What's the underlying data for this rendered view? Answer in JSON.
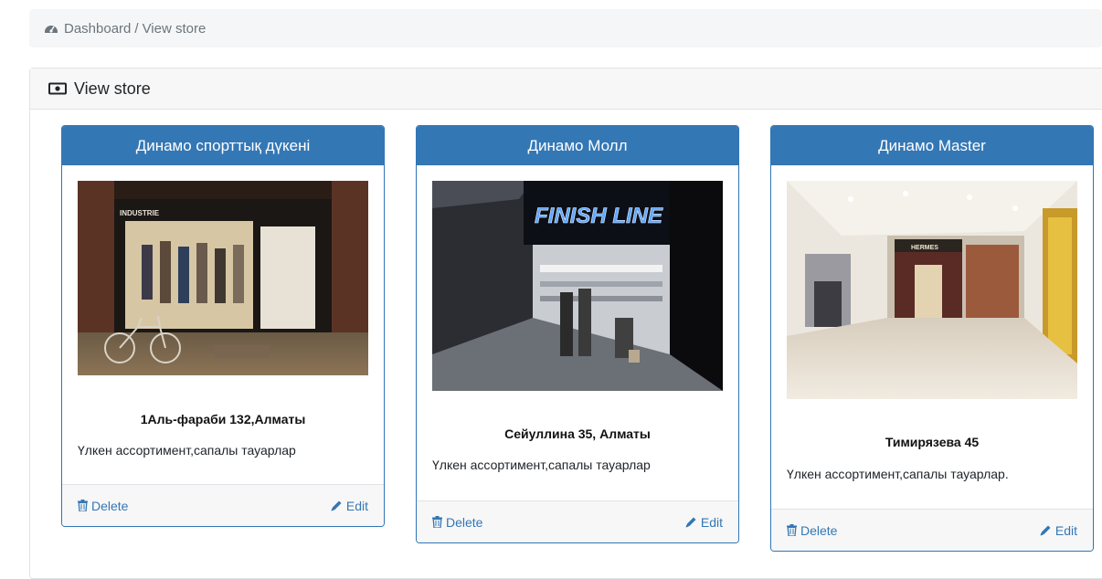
{
  "breadcrumb": {
    "icon": "dashboard-icon",
    "items": [
      "Dashboard",
      "View store"
    ],
    "separator": "/"
  },
  "panel": {
    "icon": "banknote-icon",
    "title": "View store"
  },
  "stores": [
    {
      "name": "Динамо спорттық дүкені",
      "address": "1Аль-фараби 132,Алматы",
      "description": "Үлкен ассортимент,сапалы тауарлар",
      "image": "storefront-photo"
    },
    {
      "name": "Динамо Молл",
      "address": "Сейуллина 35, Алматы",
      "description": "Үлкен ассортимент,сапалы тауарлар",
      "image": "finish-line-store-photo",
      "image_sign": "FINISH LINE"
    },
    {
      "name": "Динамо Master",
      "address": "Тимирязева 45",
      "description": "Үлкен ассортимент,сапалы тауарлар.",
      "image": "mall-interior-photo",
      "image_sign": "HERMES"
    }
  ],
  "actions": {
    "delete_label": "Delete",
    "edit_label": "Edit",
    "delete_icon": "trash-icon",
    "edit_icon": "pencil-icon"
  },
  "colors": {
    "primary": "#3477b5",
    "card_border": "#2f76b6",
    "breadcrumb_bg": "#f5f6f7",
    "muted_text": "#6c757d"
  }
}
